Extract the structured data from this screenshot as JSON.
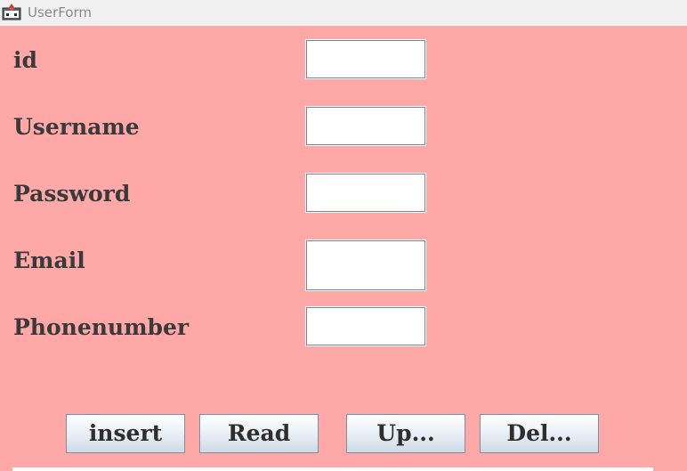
{
  "window": {
    "title": "UserForm",
    "icon": "java-app-icon"
  },
  "form": {
    "fields": [
      {
        "label": "id",
        "value": ""
      },
      {
        "label": "Username",
        "value": ""
      },
      {
        "label": "Password",
        "value": ""
      },
      {
        "label": "Email",
        "value": ""
      },
      {
        "label": "Phonenumber",
        "value": ""
      }
    ]
  },
  "buttons": {
    "insert": "insert",
    "read": "Read",
    "update": "Up...",
    "delete": "Del..."
  },
  "colors": {
    "background": "#ffa8a8",
    "label_text": "#3a3a3a",
    "titlebar": "#f0f0f0"
  }
}
